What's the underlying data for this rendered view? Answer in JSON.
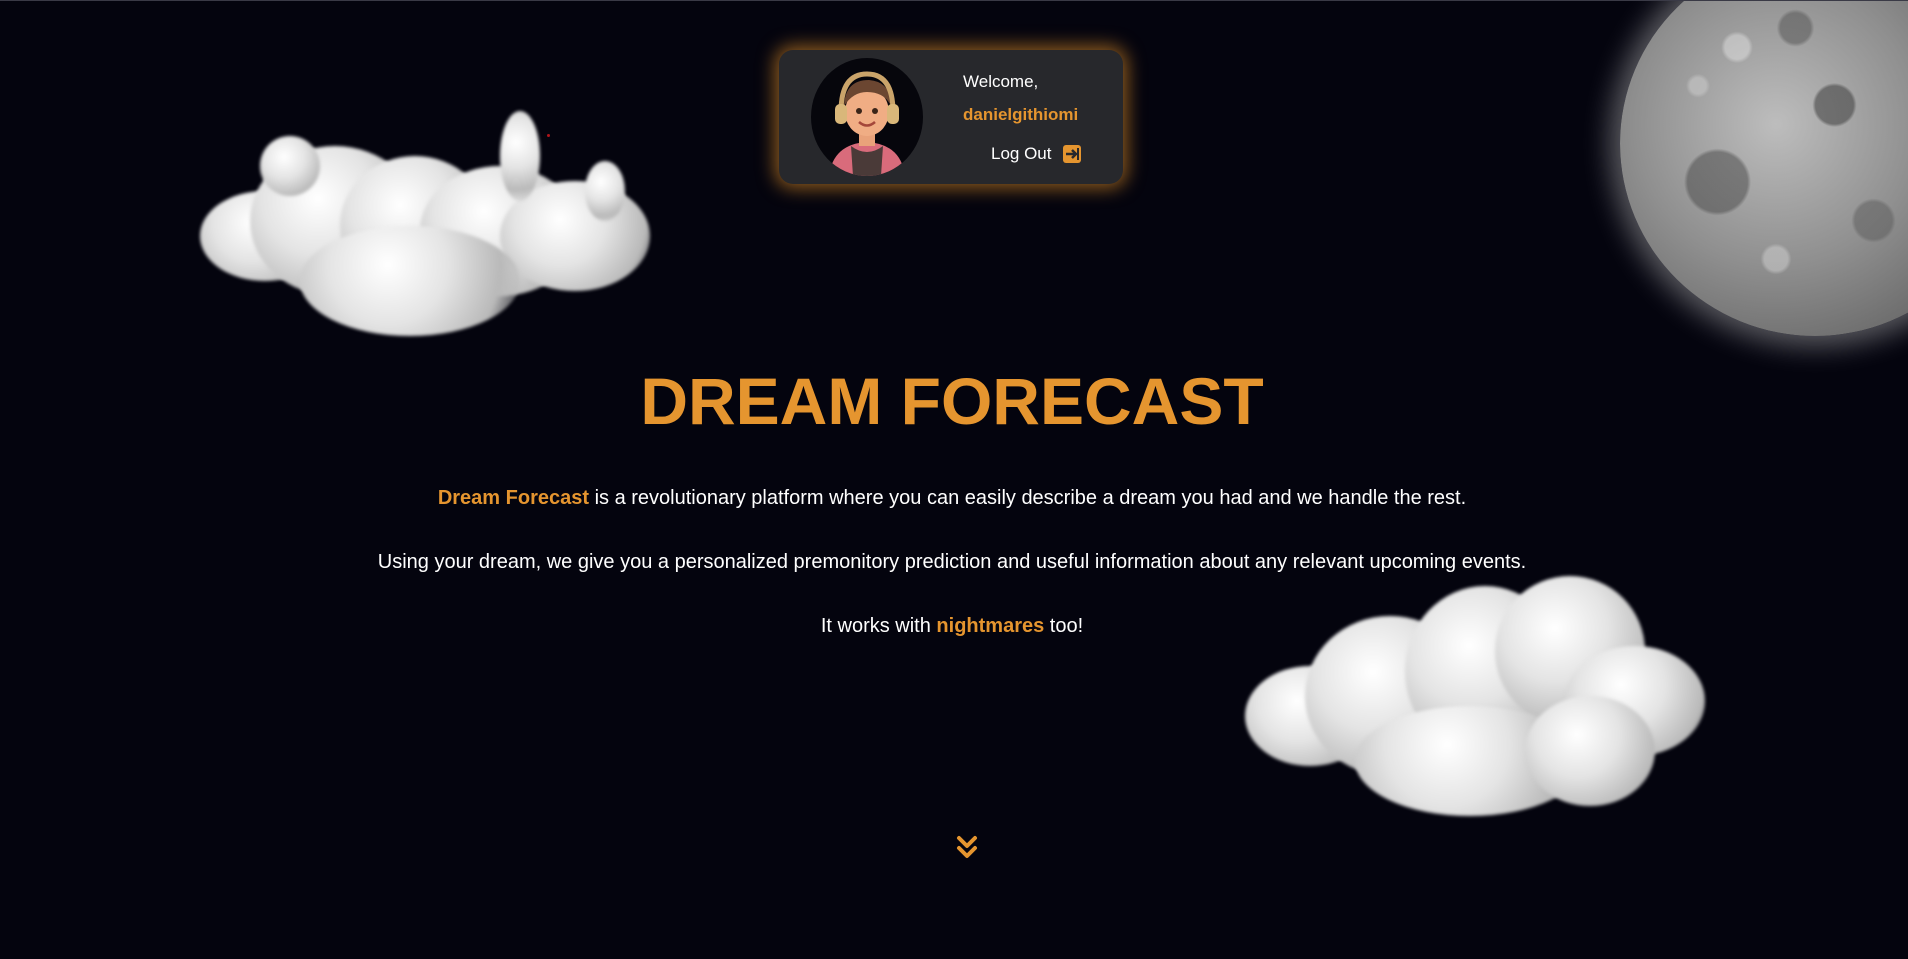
{
  "profile": {
    "welcome_text": "Welcome,",
    "username": "danielgithiomi",
    "logout_label": "Log Out",
    "avatar_icon": "avatar-person-with-headphones",
    "logout_icon": "arrow-right-from-bracket-icon"
  },
  "hero": {
    "title": "DREAM FORECAST",
    "para1_highlight": "Dream Forecast",
    "para1_rest": " is a revolutionary platform where you can easily describe a dream you had and we handle the rest.",
    "para2": "Using your dream, we give you a personalized premonitory prediction and useful information about any relevant upcoming events.",
    "para3_before": "It works with ",
    "para3_highlight": "nightmares",
    "para3_after": " too!"
  },
  "scroll_icon": "double-chevron-down-icon",
  "colors": {
    "background": "#04040e",
    "accent": "#e5952f",
    "card": "#27282c",
    "text": "#ffffff"
  }
}
